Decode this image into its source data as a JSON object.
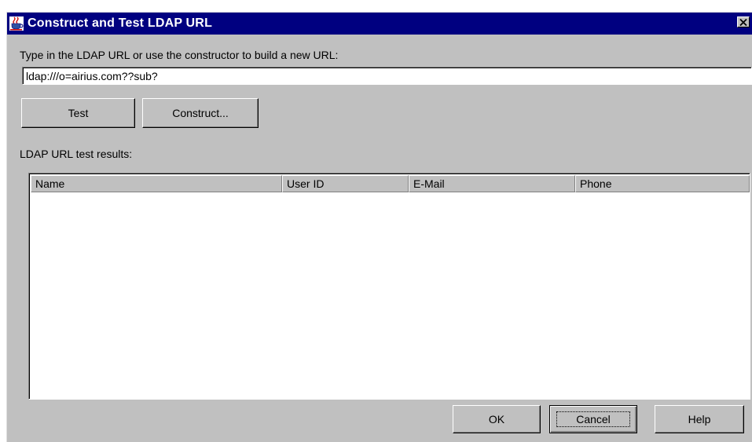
{
  "window": {
    "title": "Construct and Test LDAP URL",
    "close_glyph": "✕"
  },
  "url_prompt": "Type in the LDAP URL or use the constructor to build a new URL:",
  "url_field": {
    "value": "ldap:///o=airius.com??sub?"
  },
  "action_buttons": {
    "test": "Test",
    "construct": "Construct..."
  },
  "results": {
    "label": "LDAP URL test results:",
    "columns": [
      "Name",
      "User ID",
      "E-Mail",
      "Phone"
    ],
    "rows": []
  },
  "footer_buttons": {
    "ok": "OK",
    "cancel": "Cancel",
    "help": "Help"
  },
  "colors": {
    "titlebar": "#000080",
    "face": "#c0c0c0"
  },
  "icons": {
    "app": "java-coffee-cup-icon",
    "close": "close-icon"
  }
}
